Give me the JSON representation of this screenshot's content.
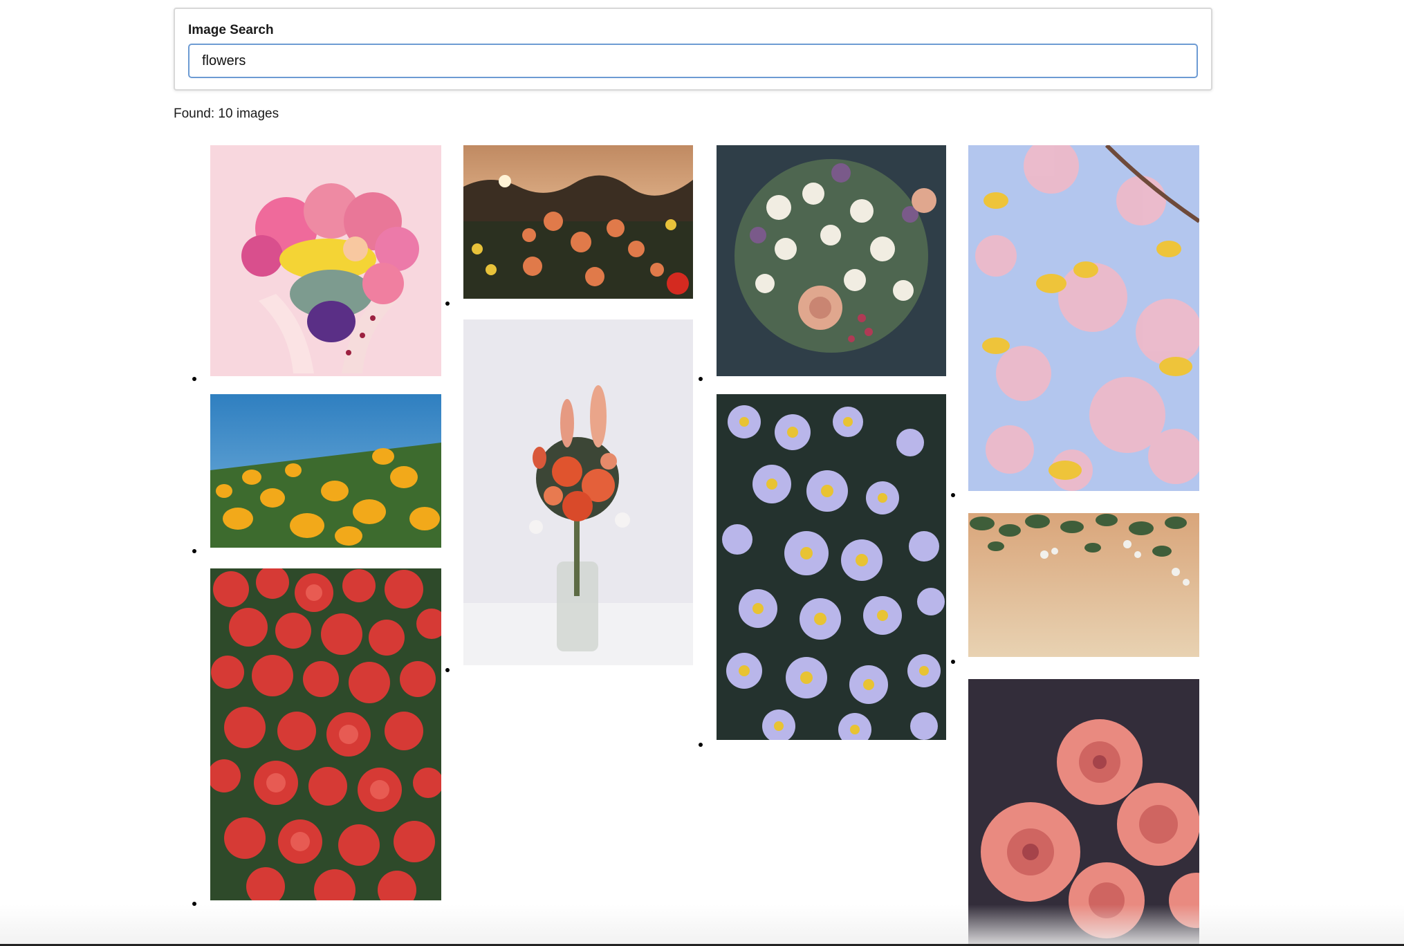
{
  "search": {
    "label": "Image Search",
    "value": "flowers",
    "placeholder": ""
  },
  "results": {
    "count_text": "Found: 10 images"
  },
  "images": [
    {
      "subject": "heart-shaped flower bouquet held in hands on pink background"
    },
    {
      "subject": "yellow poppies under blue sky"
    },
    {
      "subject": "field of red begonias"
    },
    {
      "subject": "orange flowers at sunset"
    },
    {
      "subject": "mixed flower bouquet in glass vase"
    },
    {
      "subject": "bouquet of white and pink roses"
    },
    {
      "subject": "purple asters with yellow centers"
    },
    {
      "subject": "pink cherry blossoms against blue sky"
    },
    {
      "subject": "flower vines on wooden surface"
    },
    {
      "subject": "pink roses on dark background"
    }
  ]
}
